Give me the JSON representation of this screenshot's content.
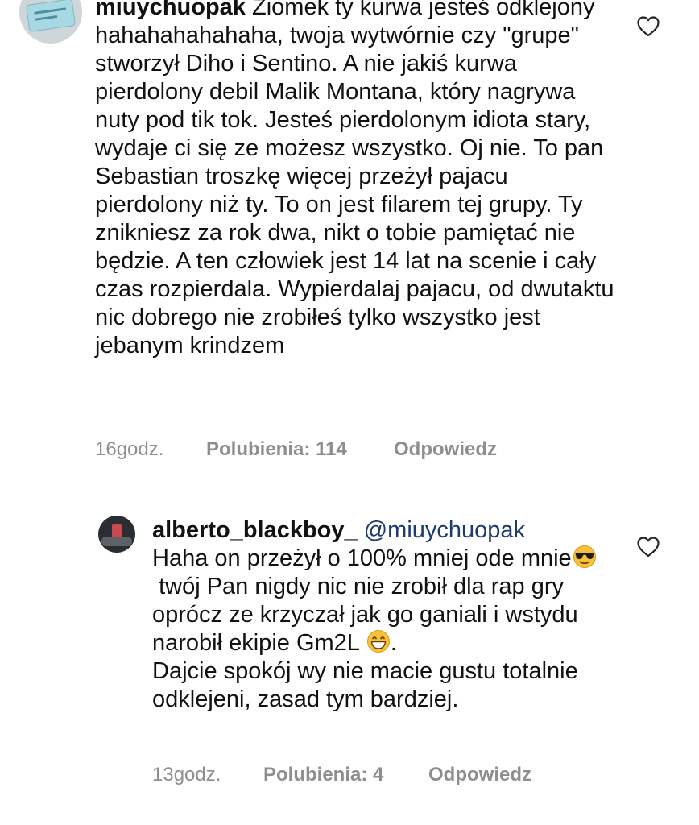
{
  "comment": {
    "username": "miuychuopak",
    "text": " Ziomek ty kurwa jesteś odklejony hahahahahahaha, twoja wytwórnie czy \"grupe\" stworzył Diho i Sentino. A nie jakiś kurwa pierdolony debil Malik Montana, który nagrywa nuty pod tik tok. Jesteś pierdolonym idiota stary, wydaje ci się ze możesz wszystko. Oj nie. To pan Sebastian troszkę więcej przeżył pajacu pierdolony niż ty. To on jest filarem tej grupy. Ty znikniesz za rok dwa, nikt o tobie pamiętać nie będzie. A ten człowiek jest 14 lat na scenie i cały czas rozpierdala. Wypierdalaj pajacu, od dwutaktu nic dobrego nie zrobiłeś tylko wszystko jest jebanym krindzem",
    "time": "16godz.",
    "likes": "Polubienia: 114",
    "reply_label": "Odpowiedz",
    "heart_icon": "heart-outline-icon"
  },
  "reply": {
    "username": "alberto_blackboy_",
    "mention": "@miuychuopak",
    "line1": "Haha on przeżył o 100% mniej ode mnie",
    "line2": " twój Pan nigdy nic nie zrobił dla rap gry oprócz ze krzyczał jak go ganiali i wstydu narobił ekipie Gm2L ",
    "line3": ".",
    "line4": "Dajcie spokój wy nie macie gustu totalnie odklejeni, zasad tym bardziej.",
    "emoji1": "sunglasses-emoji",
    "emoji2": "grinning-emoji",
    "time": "13godz.",
    "likes": "Polubienia: 4",
    "reply_label": "Odpowiedz",
    "heart_icon": "heart-outline-icon"
  },
  "colors": {
    "text": "#111111",
    "meta": "#8e8e8e",
    "mention": "#1f3a6e",
    "background": "#ffffff"
  }
}
